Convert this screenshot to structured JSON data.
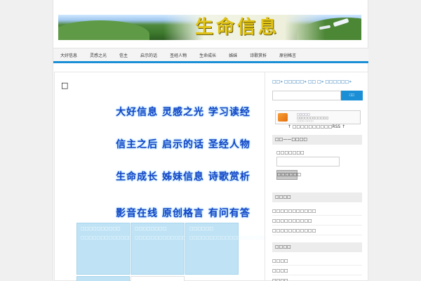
{
  "site": {
    "banner_title": "生命信息"
  },
  "nav": {
    "items": [
      "大好信息",
      "灵感之光",
      "信主",
      "启示的话",
      "圣经人物",
      "生命成长",
      "姊妹",
      "诗歌赏析",
      "原创格言"
    ]
  },
  "post": {
    "title": "□",
    "motto_lines": [
      "大好信息 灵感之光 学习读经",
      "信主之后 启示的话 圣经人物",
      "生命成长 姊妹信息 诗歌赏析",
      "影音在线 原创格言 有问有答"
    ],
    "cells": [
      {
        "title": "□□□□□□□□□□",
        "body": "□□□□□□□□□□□□□□□□□□□□□□□□□□□□□□□□□□□□□□□□□□□□□□□□□□□□□"
      },
      {
        "title": "□□□□□□□□",
        "body": "□□□□□□□□□□□□□□□□□□□□□□□□□□□□□□□□□□□□□□□□□□□□□"
      },
      {
        "title": "□□□□□□",
        "body": "□□□□□□□□□□□□□□□□□□□□□□□□□□"
      }
    ]
  },
  "sidebar": {
    "top_links": "□□» □□□□□» □□ □» □□□□□□»",
    "search": {
      "placeholder": "",
      "button_label": "□□"
    },
    "rss": {
      "line1": "□□□□□",
      "line2": "□□□□□□□□□□□□",
      "line3": "□□□□ □□□□",
      "caption": "↑ □□□□□□□□□□RSS ↑"
    },
    "login": {
      "heading": "□□——□□□□",
      "label": "□□□□□□□",
      "button_label": "□□□□□□"
    },
    "widget2": {
      "heading": "□□□□",
      "items": [
        "□□□□□□□□□□□",
        "□□□□□□□□□□",
        "□□□□□□□□□□□"
      ]
    },
    "widget3": {
      "heading": "□□□□",
      "items": [
        "□□□□",
        "□□□□",
        "□□□□"
      ]
    }
  }
}
